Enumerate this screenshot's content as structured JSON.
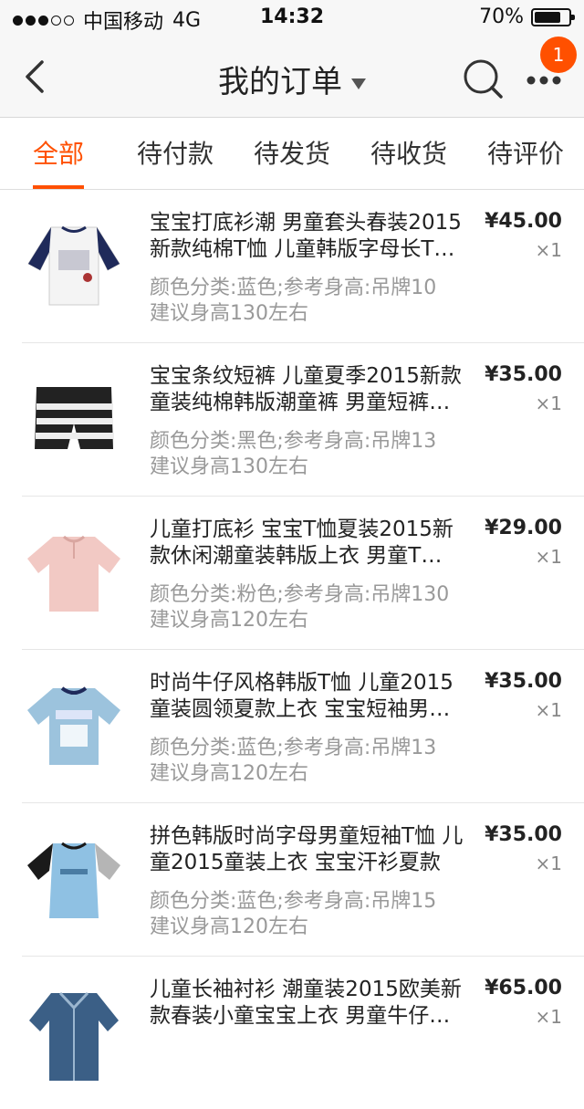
{
  "status_bar": {
    "carrier": "中国移动",
    "network": "4G",
    "time": "14:32",
    "battery_percent": "70%"
  },
  "nav": {
    "title": "我的订单",
    "badge_count": "1"
  },
  "tabs": [
    {
      "label": "全部",
      "active": true
    },
    {
      "label": "待付款",
      "active": false
    },
    {
      "label": "待发货",
      "active": false
    },
    {
      "label": "待收货",
      "active": false
    },
    {
      "label": "待评价",
      "active": false
    }
  ],
  "items": [
    {
      "name": "宝宝打底衫潮 男童套头春装2015新款纯棉T恤 儿童韩版字母长T…",
      "sku1": "颜色分类:蓝色;参考身高:吊牌10",
      "sku2": "建议身高130左右",
      "price": "¥45.00",
      "qty": "×1"
    },
    {
      "name": "宝宝条纹短裤 儿童夏季2015新款童装纯棉韩版潮童裤 男童短裤…",
      "sku1": "颜色分类:黑色;参考身高:吊牌13",
      "sku2": "建议身高130左右",
      "price": "¥35.00",
      "qty": "×1"
    },
    {
      "name": "儿童打底衫 宝宝T恤夏装2015新款休闲潮童装韩版上衣 男童T…",
      "sku1": "颜色分类:粉色;参考身高:吊牌130",
      "sku2": "建议身高120左右",
      "price": "¥29.00",
      "qty": "×1"
    },
    {
      "name": "时尚牛仔风格韩版T恤 儿童2015童装圆领夏款上衣 宝宝短袖男…",
      "sku1": "颜色分类:蓝色;参考身高:吊牌13",
      "sku2": "建议身高120左右",
      "price": "¥35.00",
      "qty": "×1"
    },
    {
      "name": "拼色韩版时尚字母男童短袖T恤 儿童2015童装上衣 宝宝汗衫夏款",
      "sku1": "颜色分类:蓝色;参考身高:吊牌15",
      "sku2": "建议身高120左右",
      "price": "¥35.00",
      "qty": "×1"
    },
    {
      "name": "儿童长袖衬衫 潮童装2015欧美新款春装小童宝宝上衣 男童牛仔…",
      "sku1": "",
      "sku2": "",
      "price": "¥65.00",
      "qty": "×1"
    }
  ],
  "colors": {
    "accent": "#ff5000"
  }
}
